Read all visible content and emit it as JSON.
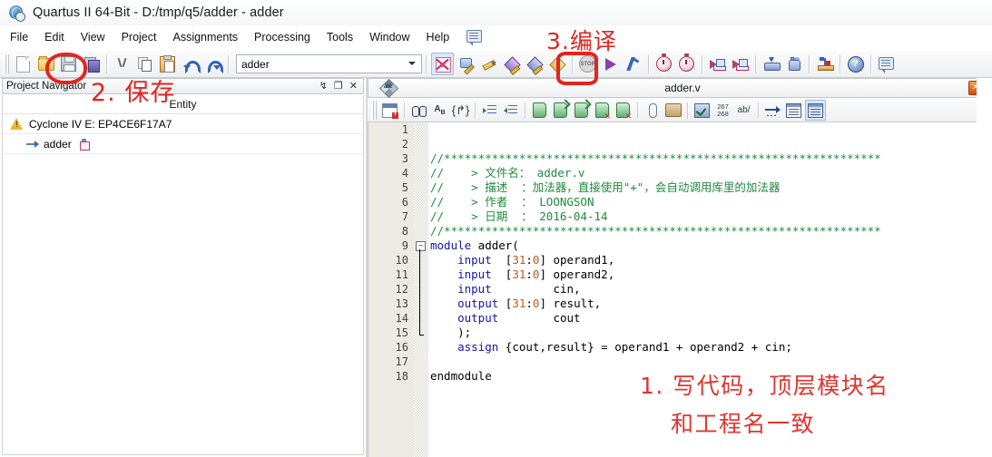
{
  "window": {
    "title": "Quartus II 64-Bit - D:/tmp/q5/adder - adder",
    "icon": "quartus-globe-icon"
  },
  "menubar": {
    "items": [
      {
        "label": "File"
      },
      {
        "label": "Edit"
      },
      {
        "label": "View"
      },
      {
        "label": "Project"
      },
      {
        "label": "Assignments"
      },
      {
        "label": "Processing"
      },
      {
        "label": "Tools"
      },
      {
        "label": "Window"
      },
      {
        "label": "Help"
      }
    ],
    "note_icon": "speech-bubble-icon"
  },
  "toolbar": {
    "project_combo_value": "adder",
    "buttons": [
      {
        "name": "new-file-button",
        "icon": "new-document-icon"
      },
      {
        "name": "open-file-button",
        "icon": "open-folder-icon"
      },
      {
        "name": "save-file-button",
        "icon": "floppy-disk-icon"
      },
      {
        "name": "save-all-button",
        "icon": "save-all-icon"
      },
      {
        "name": "cut-button",
        "icon": "scissors-icon"
      },
      {
        "name": "copy-button",
        "icon": "copy-icon"
      },
      {
        "name": "paste-button",
        "icon": "clipboard-paste-icon"
      },
      {
        "name": "undo-button",
        "icon": "undo-arrow-icon"
      },
      {
        "name": "redo-button",
        "icon": "redo-arrow-icon"
      },
      {
        "name": "start-compilation-report-button",
        "icon": "red-star-icon"
      },
      {
        "name": "settings-button",
        "icon": "chip-pencil-icon"
      },
      {
        "name": "assignment-editor-button",
        "icon": "pencil-icon"
      },
      {
        "name": "pin-planner-button",
        "icon": "diamond-pencil-icon"
      },
      {
        "name": "floorplan-button",
        "icon": "diamond-blue-icon"
      },
      {
        "name": "timing-closure-button",
        "icon": "diamond-yellow-icon"
      },
      {
        "name": "stop-compilation-button",
        "icon": "stop-sign-icon"
      },
      {
        "name": "start-compilation-button",
        "icon": "play-triangle-icon"
      },
      {
        "name": "analysis-synthesis-button",
        "icon": "blue-bolt-icon"
      },
      {
        "name": "timing-analyzer-button",
        "icon": "stopwatch-pink-icon"
      },
      {
        "name": "timequest-button",
        "icon": "stopwatch-red-icon"
      },
      {
        "name": "simulation-in-button",
        "icon": "waveform-in-icon"
      },
      {
        "name": "simulation-out-button",
        "icon": "waveform-out-icon"
      },
      {
        "name": "programmer-button",
        "icon": "download-chip-icon"
      },
      {
        "name": "signaltap-button",
        "icon": "hand-probe-icon"
      },
      {
        "name": "pin-tool-button",
        "icon": "pin-tool-icon"
      },
      {
        "name": "help-button",
        "icon": "blue-question-icon"
      },
      {
        "name": "message-button",
        "icon": "speech-bubble-icon"
      }
    ]
  },
  "project_navigator": {
    "title": "Project Navigator",
    "header_buttons": [
      {
        "name": "pin-panel-button",
        "glyph": "↯"
      },
      {
        "name": "restore-panel-button",
        "glyph": "❐"
      },
      {
        "name": "close-panel-button",
        "glyph": "✕"
      }
    ],
    "column_header": "Entity",
    "rows": [
      {
        "label": "Cyclone IV E: EP4CE6F17A7",
        "icon": "warning-triangle-icon",
        "indent": 0
      },
      {
        "label": "adder",
        "icon": "entity-arrow-icon",
        "badge": "chip-icon",
        "indent": 1
      }
    ]
  },
  "editor": {
    "tab_title": "adder.v",
    "tab_icon": "file-type-icon",
    "close_label": "✕",
    "toolbar_buttons": [
      {
        "name": "new-text-file-button",
        "icon": "new-document-plus-icon"
      },
      {
        "name": "find-button",
        "icon": "binoculars-icon"
      },
      {
        "name": "replace-button",
        "icon": "a-to-b-icon"
      },
      {
        "name": "goto-line-button",
        "icon": "braces-arrow-icon"
      },
      {
        "name": "increase-indent-button",
        "icon": "indent-right-icon"
      },
      {
        "name": "decrease-indent-button",
        "icon": "indent-left-icon"
      },
      {
        "name": "bookmark-toggle-button",
        "icon": "bookmark-icon"
      },
      {
        "name": "bookmark-next-button",
        "icon": "bookmark-next-icon"
      },
      {
        "name": "bookmark-prev-button",
        "icon": "bookmark-prev-icon"
      },
      {
        "name": "bookmark-clear-button",
        "icon": "bookmark-clear-icon"
      },
      {
        "name": "bookmark-clear-all-button",
        "icon": "bookmark-clear-all-icon"
      },
      {
        "name": "insert-template-button",
        "icon": "paperclip-icon"
      },
      {
        "name": "insert-file-button",
        "icon": "scroll-icon"
      },
      {
        "name": "check-syntax-button",
        "icon": "check-document-icon"
      },
      {
        "name": "line-numbers-button",
        "icon": "267-268-icon",
        "label_top": "267",
        "label_bottom": "268"
      },
      {
        "name": "word-wrap-button",
        "icon": "ab-slash-icon",
        "label": "ab/"
      },
      {
        "name": "jump-button",
        "icon": "dashed-arrow-icon"
      },
      {
        "name": "split-pane-button",
        "icon": "pane-icon"
      },
      {
        "name": "full-screen-button",
        "icon": "pane-selected-icon"
      }
    ],
    "code_lines": [
      {
        "n": "1",
        "segments": []
      },
      {
        "n": "2",
        "segments": []
      },
      {
        "n": "3",
        "segments": [
          {
            "t": "//****************************************************************",
            "c": "cm"
          }
        ]
      },
      {
        "n": "4",
        "segments": [
          {
            "t": "//    > 文件名： adder.v",
            "c": "cm"
          }
        ]
      },
      {
        "n": "5",
        "segments": [
          {
            "t": "//    > 描述  ：加法器，直接使用\"+\"，会自动调用库里的加法器",
            "c": "cm"
          }
        ]
      },
      {
        "n": "6",
        "segments": [
          {
            "t": "//    > 作者  ： LOONGSON",
            "c": "cm"
          }
        ]
      },
      {
        "n": "7",
        "segments": [
          {
            "t": "//    > 日期  ： 2016-04-14",
            "c": "cm"
          }
        ]
      },
      {
        "n": "8",
        "segments": [
          {
            "t": "//****************************************************************",
            "c": "cm"
          }
        ]
      },
      {
        "n": "9",
        "segments": [
          {
            "t": "module",
            "c": "kw"
          },
          {
            "t": " adder(",
            "c": ""
          }
        ]
      },
      {
        "n": "10",
        "segments": [
          {
            "t": "    ",
            "c": ""
          },
          {
            "t": "input",
            "c": "kw"
          },
          {
            "t": "  [",
            "c": ""
          },
          {
            "t": "31",
            "c": "num"
          },
          {
            "t": ":",
            "c": ""
          },
          {
            "t": "0",
            "c": "num"
          },
          {
            "t": "] operand1,",
            "c": ""
          }
        ]
      },
      {
        "n": "11",
        "segments": [
          {
            "t": "    ",
            "c": ""
          },
          {
            "t": "input",
            "c": "kw"
          },
          {
            "t": "  [",
            "c": ""
          },
          {
            "t": "31",
            "c": "num"
          },
          {
            "t": ":",
            "c": ""
          },
          {
            "t": "0",
            "c": "num"
          },
          {
            "t": "] operand2,",
            "c": ""
          }
        ]
      },
      {
        "n": "12",
        "segments": [
          {
            "t": "    ",
            "c": ""
          },
          {
            "t": "input",
            "c": "kw"
          },
          {
            "t": "         cin,",
            "c": ""
          }
        ]
      },
      {
        "n": "13",
        "segments": [
          {
            "t": "    ",
            "c": ""
          },
          {
            "t": "output",
            "c": "kw"
          },
          {
            "t": " [",
            "c": ""
          },
          {
            "t": "31",
            "c": "num"
          },
          {
            "t": ":",
            "c": ""
          },
          {
            "t": "0",
            "c": "num"
          },
          {
            "t": "] result,",
            "c": ""
          }
        ]
      },
      {
        "n": "14",
        "segments": [
          {
            "t": "    ",
            "c": ""
          },
          {
            "t": "output",
            "c": "kw"
          },
          {
            "t": "        cout",
            "c": ""
          }
        ]
      },
      {
        "n": "15",
        "segments": [
          {
            "t": "    );",
            "c": ""
          }
        ]
      },
      {
        "n": "16",
        "segments": [
          {
            "t": "    ",
            "c": ""
          },
          {
            "t": "assign",
            "c": "kw"
          },
          {
            "t": " {cout,result} = operand1 + operand2 + cin;",
            "c": ""
          }
        ]
      },
      {
        "n": "17",
        "segments": []
      },
      {
        "n": "18",
        "segments": [
          {
            "t": "endmodule",
            "c": ""
          }
        ]
      }
    ]
  },
  "annotations": {
    "save_label": "2. 保存",
    "compile_label": "3.编译",
    "code_note_line1": "1. 写代码，顶层模块名",
    "code_note_line2": "和工程名一致",
    "color": "#e2251f"
  }
}
